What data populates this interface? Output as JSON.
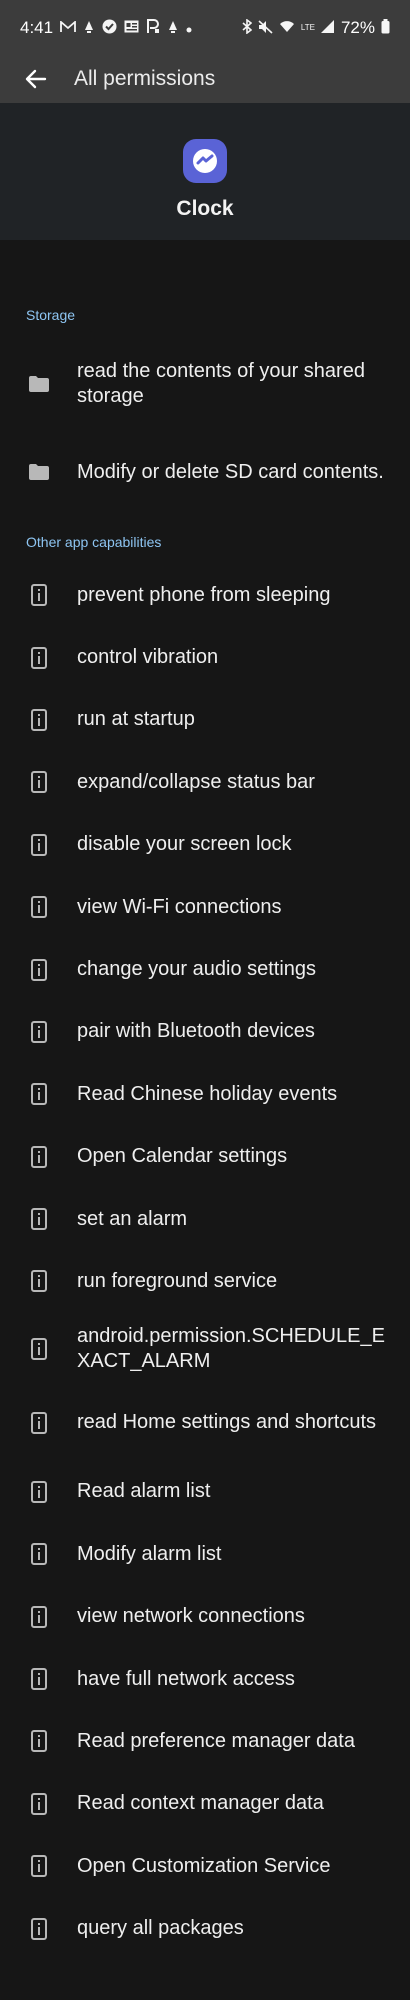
{
  "status_bar": {
    "time": "4:41",
    "left_icons": [
      "mail-icon",
      "notification-icon",
      "check-icon",
      "news-icon",
      "p-icon",
      "notification-icon",
      "dot-icon"
    ],
    "right_icons": [
      "bluetooth-icon",
      "mute-icon",
      "wifi-icon",
      "lte-icon",
      "signal-icon"
    ],
    "lte_text": "LTE",
    "battery": "72%"
  },
  "app_bar": {
    "title": "All permissions"
  },
  "app": {
    "name": "Clock",
    "icon_color": "#5a63d6"
  },
  "sections": [
    {
      "header": "Storage",
      "items": [
        {
          "label": "read the contents of your shared storage",
          "icon": "folder-icon"
        },
        {
          "label": "Modify or delete SD card contents.",
          "icon": "folder-icon"
        }
      ]
    },
    {
      "header": "Other app capabilities",
      "items": [
        {
          "label": "prevent phone from sleeping",
          "icon": "phone-info-icon"
        },
        {
          "label": "control vibration",
          "icon": "phone-info-icon"
        },
        {
          "label": "run at startup",
          "icon": "phone-info-icon"
        },
        {
          "label": "expand/collapse status bar",
          "icon": "phone-info-icon"
        },
        {
          "label": "disable your screen lock",
          "icon": "phone-info-icon"
        },
        {
          "label": "view Wi-Fi connections",
          "icon": "phone-info-icon"
        },
        {
          "label": "change your audio settings",
          "icon": "phone-info-icon"
        },
        {
          "label": "pair with Bluetooth devices",
          "icon": "phone-info-icon"
        },
        {
          "label": "Read Chinese holiday events",
          "icon": "phone-info-icon"
        },
        {
          "label": "Open Calendar settings",
          "icon": "phone-info-icon"
        },
        {
          "label": "set an alarm",
          "icon": "phone-info-icon"
        },
        {
          "label": "run foreground service",
          "icon": "phone-info-icon"
        },
        {
          "label": "android.permission.SCHEDULE_EXACT_ALARM",
          "icon": "phone-info-icon"
        },
        {
          "label": "read Home settings and shortcuts",
          "icon": "phone-info-icon"
        },
        {
          "label": "Read alarm list",
          "icon": "phone-info-icon"
        },
        {
          "label": "Modify alarm list",
          "icon": "phone-info-icon"
        },
        {
          "label": "view network connections",
          "icon": "phone-info-icon"
        },
        {
          "label": "have full network access",
          "icon": "phone-info-icon"
        },
        {
          "label": "Read preference manager data",
          "icon": "phone-info-icon"
        },
        {
          "label": "Read context manager data",
          "icon": "phone-info-icon"
        },
        {
          "label": "Open Customization Service",
          "icon": "phone-info-icon"
        },
        {
          "label": "query all packages",
          "icon": "phone-info-icon"
        }
      ]
    }
  ],
  "colors": {
    "section_header": "#8ec5f2",
    "app_bar_bg": "#3c3c3c",
    "background": "#161616"
  }
}
